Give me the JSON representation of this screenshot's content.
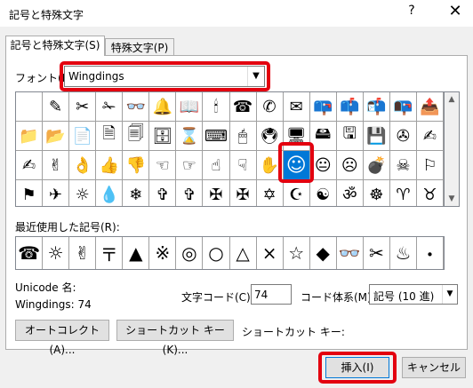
{
  "window": {
    "title": "記号と特殊文字",
    "help": "?",
    "close": "✕"
  },
  "tabs": [
    {
      "label": "記号と特殊文字(S)"
    },
    {
      "label": "特殊文字(P)"
    }
  ],
  "font": {
    "label": "フォント(F):",
    "value": "Wingdings"
  },
  "symbol_grid": {
    "rows": [
      [
        " ",
        "✎",
        "✂",
        "✁",
        "👓",
        "🔔",
        "📖",
        "🕯",
        "☎",
        "✆",
        "✉",
        "📪",
        "📫",
        "📬",
        "📭",
        "📤"
      ],
      [
        "📁",
        "📂",
        "📄",
        "🗎",
        "🗐",
        "🗄",
        "⌛",
        "⌨",
        "🖱",
        "🖲",
        "🖥",
        "🖴",
        "🖫",
        "💾",
        "✇",
        "✍"
      ],
      [
        "✍",
        "✌",
        "👌",
        "👍",
        "👎",
        "☜",
        "☞",
        "☝",
        "☟",
        "✋",
        "☺",
        "😐",
        "☹",
        "💣",
        "☠",
        "⚐"
      ],
      [
        "⚑",
        "✈",
        "☼",
        "💧",
        "❄",
        "✞",
        "✞",
        "✠",
        "✠",
        "✡",
        "☪",
        "☯",
        "ॐ",
        "☸",
        "♈",
        "♉"
      ]
    ],
    "selected": "☺"
  },
  "recent": {
    "label": "最近使用した記号(R):",
    "symbols": [
      "☎",
      "☼",
      "✌",
      "〒",
      "▲",
      "※",
      "◎",
      "○",
      "△",
      "×",
      "☆",
      "◆",
      "👓",
      "✂",
      "♨",
      "・"
    ]
  },
  "unicode_label": "Unicode 名:",
  "char_name": "Wingdings: 74",
  "char_code": {
    "label": "文字コード(C):",
    "value": "74"
  },
  "charset": {
    "label": "コード体系(M):",
    "value": "記号 (10 進)"
  },
  "buttons": {
    "autocorrect": "オートコレクト(A)...",
    "shortcut": "ショートカット キー(K)...",
    "shortcut_label": "ショートカット キー:",
    "insert": "挿入(I)",
    "cancel": "キャンセル"
  },
  "colors": {
    "selection": "#0078d7",
    "highlight": "#e3000f"
  }
}
